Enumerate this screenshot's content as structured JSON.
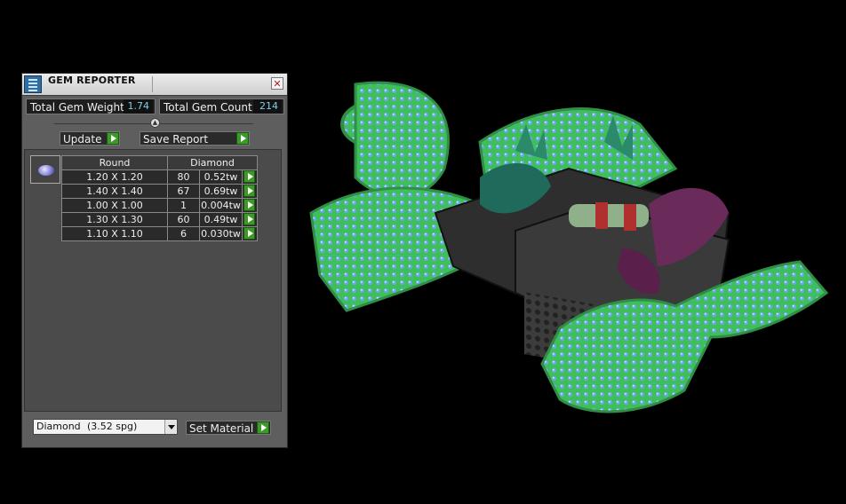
{
  "window": {
    "title": "GEM REPORTER",
    "close_glyph": "✕"
  },
  "stats": {
    "weight_label": "Total Gem Weight",
    "weight_value": "1.74",
    "count_label": "Total Gem Count",
    "count_value": "214"
  },
  "buttons": {
    "update": "Update",
    "save_report": "Save Report",
    "set_material": "Set Material"
  },
  "table": {
    "header_shape": "Round",
    "header_material": "Diamond",
    "rows": [
      {
        "size": "1.20 X 1.20",
        "count": "80",
        "weight": "0.52tw"
      },
      {
        "size": "1.40 X 1.40",
        "count": "67",
        "weight": "0.69tw"
      },
      {
        "size": "1.00 X 1.00",
        "count": "1",
        "weight": "0.004tw"
      },
      {
        "size": "1.30 X 1.30",
        "count": "60",
        "weight": "0.49tw"
      },
      {
        "size": "1.10 X 1.10",
        "count": "6",
        "weight": "0.030tw"
      }
    ]
  },
  "material_select": {
    "name": "Diamond",
    "spg": "(3.52 spg)"
  },
  "colors": {
    "accent_green": "#3c9a2a",
    "value_cyan": "#7fd0e8",
    "model_green": "#3fbf5a",
    "gem_blue": "#6aa8e8"
  },
  "icons": [
    "gem-reporter-app-icon",
    "close-icon",
    "slider-knob-icon",
    "play-arrow-icon",
    "round-gem-icon",
    "chevron-down-icon"
  ]
}
